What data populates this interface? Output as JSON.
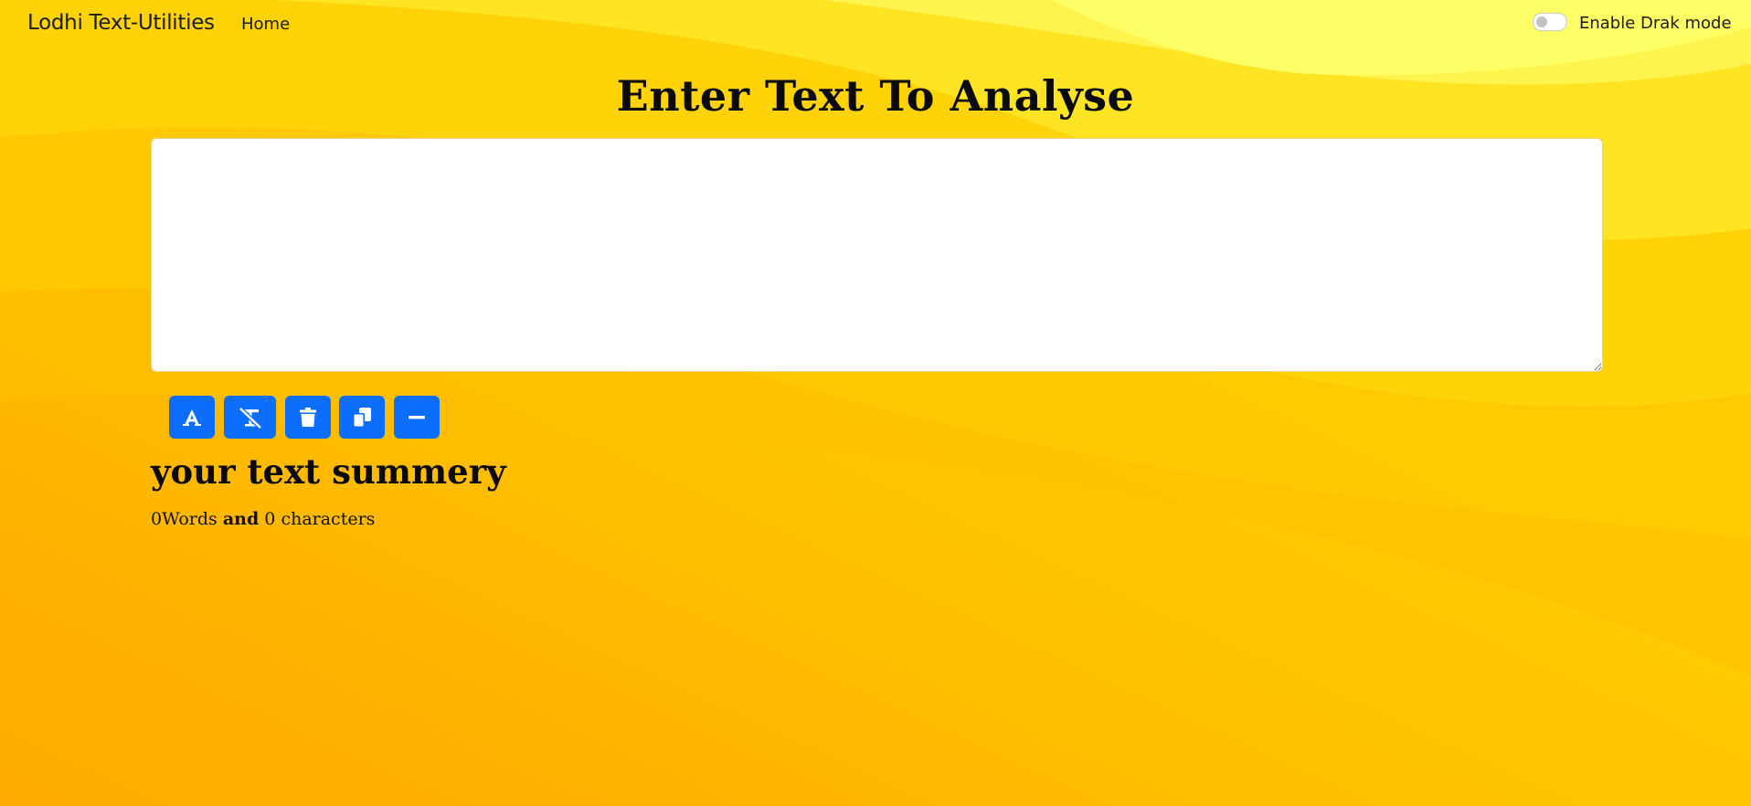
{
  "navbar": {
    "brand": "Lodhi Text-Utilities",
    "home_label": "Home",
    "dark_mode_label": "Enable Drak mode",
    "dark_mode_enabled": false
  },
  "main": {
    "title": "Enter Text To Analyse",
    "textarea_value": "",
    "buttons": [
      {
        "name": "uppercase",
        "icon": "font-icon"
      },
      {
        "name": "clear-format",
        "icon": "text-slash-icon"
      },
      {
        "name": "delete",
        "icon": "trash-icon"
      },
      {
        "name": "copy",
        "icon": "copy-icon"
      },
      {
        "name": "remove-extra-spaces",
        "icon": "minus-icon"
      }
    ]
  },
  "summary": {
    "title": "your text summery",
    "word_count": "0",
    "words_label": "Words",
    "and_label": "and",
    "char_count": "0",
    "characters_label": "characters"
  },
  "colors": {
    "background_dark": "#ffb300",
    "background_light": "#ffff66",
    "button": "#0d6efd"
  }
}
